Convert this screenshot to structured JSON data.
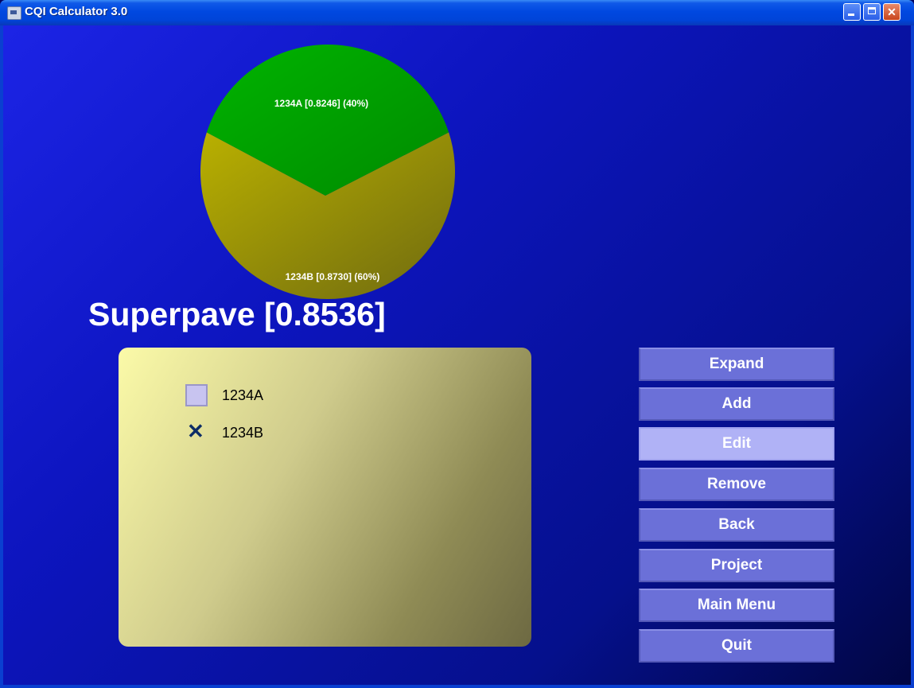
{
  "window": {
    "title": "CQI Calculator 3.0"
  },
  "chart_data": {
    "type": "pie",
    "slices": [
      {
        "label": "1234A [0.8246] (40%)",
        "value": 40,
        "color": "#00a000"
      },
      {
        "label": "1234B [0.8730] (60%)",
        "value": 60,
        "color": "#a8a000"
      }
    ]
  },
  "heading": "Superpave [0.8536]",
  "list": {
    "items": [
      {
        "label": "1234A",
        "checked": false
      },
      {
        "label": "1234B",
        "checked": true
      }
    ],
    "check_glyph": "✕"
  },
  "buttons": {
    "expand": "Expand",
    "add": "Add",
    "edit": "Edit",
    "remove": "Remove",
    "back": "Back",
    "project": "Project",
    "main_menu": "Main Menu",
    "quit": "Quit"
  },
  "colors": {
    "background_top": "#1c24e6",
    "background_bottom": "#010642",
    "button": "#6b70d8",
    "button_active": "#b0b2f6",
    "panel": "#fbfaa8"
  }
}
